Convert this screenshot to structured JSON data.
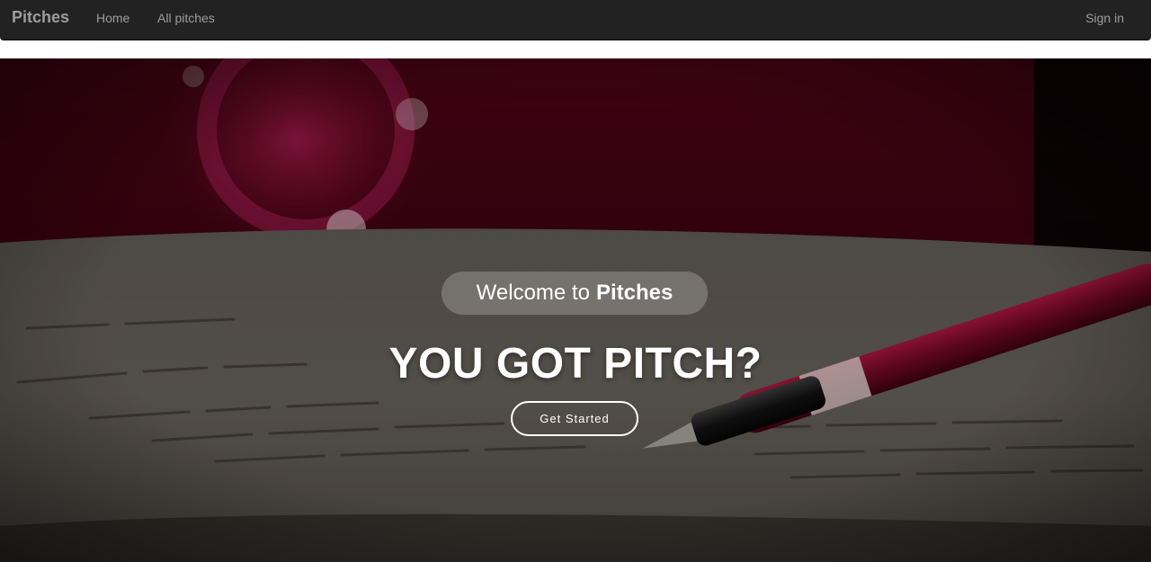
{
  "nav": {
    "brand": "Pitches",
    "links": [
      "Home",
      "All pitches"
    ],
    "signin": "Sign in"
  },
  "hero": {
    "welcome_prefix": "Welcome to",
    "welcome_brand": "Pitches",
    "headline": "YOU GOT PITCH?",
    "cta_label": "Get Started",
    "background_icon": "fountain-pen-on-paper-photo"
  },
  "colors": {
    "navbar_bg": "#222222",
    "nav_text": "#9d9d9d",
    "hero_text": "#ffffff",
    "accent_crimson": "#8a1030"
  }
}
